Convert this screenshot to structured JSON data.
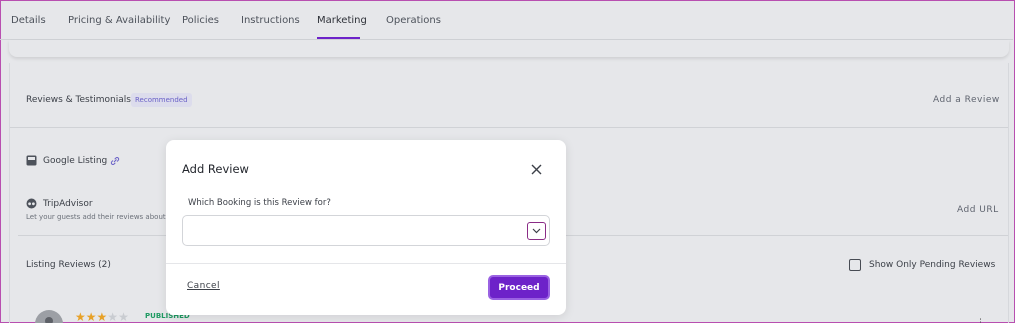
{
  "tabs": [
    {
      "label": "Details"
    },
    {
      "label": "Pricing & Availability"
    },
    {
      "label": "Policies"
    },
    {
      "label": "Instructions"
    },
    {
      "label": "Marketing"
    },
    {
      "label": "Operations"
    }
  ],
  "reviews_section": {
    "title": "Reviews & Testimonials",
    "badge": "Recommended",
    "add_review": "Add a Review"
  },
  "google": {
    "label": "Google Listing",
    "icon": "google-listing-icon",
    "link_icon": "link-icon"
  },
  "tripadvisor": {
    "label": "TripAdvisor",
    "description": "Let your guests add their reviews about",
    "add_url": "Add URL"
  },
  "listing_reviews": {
    "label": "Listing Reviews (2)",
    "show_pending": "Show Only Pending Reviews"
  },
  "review_item": {
    "rating": 3,
    "max_rating": 5,
    "status": "PUBLISHED"
  },
  "modal": {
    "title": "Add Review",
    "field_label": "Which Booking is this Review for?",
    "select_value": "",
    "cancel": "Cancel",
    "proceed": "Proceed"
  },
  "colors": {
    "accent": "#6d22c9",
    "published": "#1f9a62",
    "star": "#e7a128"
  }
}
